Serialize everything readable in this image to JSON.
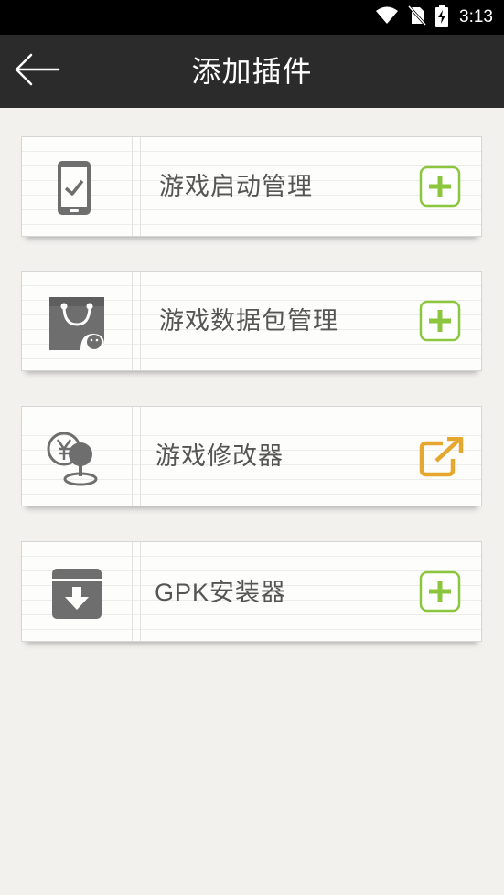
{
  "status_bar": {
    "time": "3:13",
    "icons": [
      "wifi-icon",
      "no-sim-icon",
      "battery-charging-icon"
    ]
  },
  "header": {
    "title": "添加插件",
    "back_icon": "back-arrow-icon"
  },
  "colors": {
    "header_bg": "#2b2b2b",
    "add_green": "#8cc63f",
    "open_orange": "#e5a72e",
    "icon_gray": "#6e6e6e"
  },
  "plugins": [
    {
      "label": "游戏启动管理",
      "icon": "phone-check-icon",
      "action": "add-icon"
    },
    {
      "label": "游戏数据包管理",
      "icon": "data-bag-icon",
      "action": "add-icon"
    },
    {
      "label": "游戏修改器",
      "icon": "coin-joystick-icon",
      "action": "open-external-icon"
    },
    {
      "label": "GPK安装器",
      "icon": "install-box-icon",
      "action": "add-icon"
    }
  ]
}
